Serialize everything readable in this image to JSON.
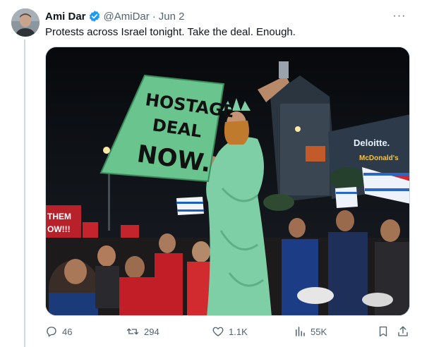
{
  "tweet": {
    "author_name": "Ami Dar",
    "handle": "@AmiDar",
    "separator": "·",
    "date": "Jun 2",
    "text": "Protests across Israel tonight. Take the deal. Enough.",
    "more_label": "···"
  },
  "photo": {
    "sign_lines": [
      "HOSTAGE",
      "DEAL",
      "NOW."
    ],
    "sign_left": "THEM\nOW!!!",
    "billboard_1": "Deloitte.",
    "billboard_2": "McDonald's"
  },
  "actions": {
    "replies": "46",
    "reposts": "294",
    "likes": "1.1K",
    "views": "55K"
  },
  "colors": {
    "verified": "#1d9bf0",
    "muted": "#536471",
    "sign_green": "#69c48e",
    "statue_green": "#7fcfa6"
  }
}
